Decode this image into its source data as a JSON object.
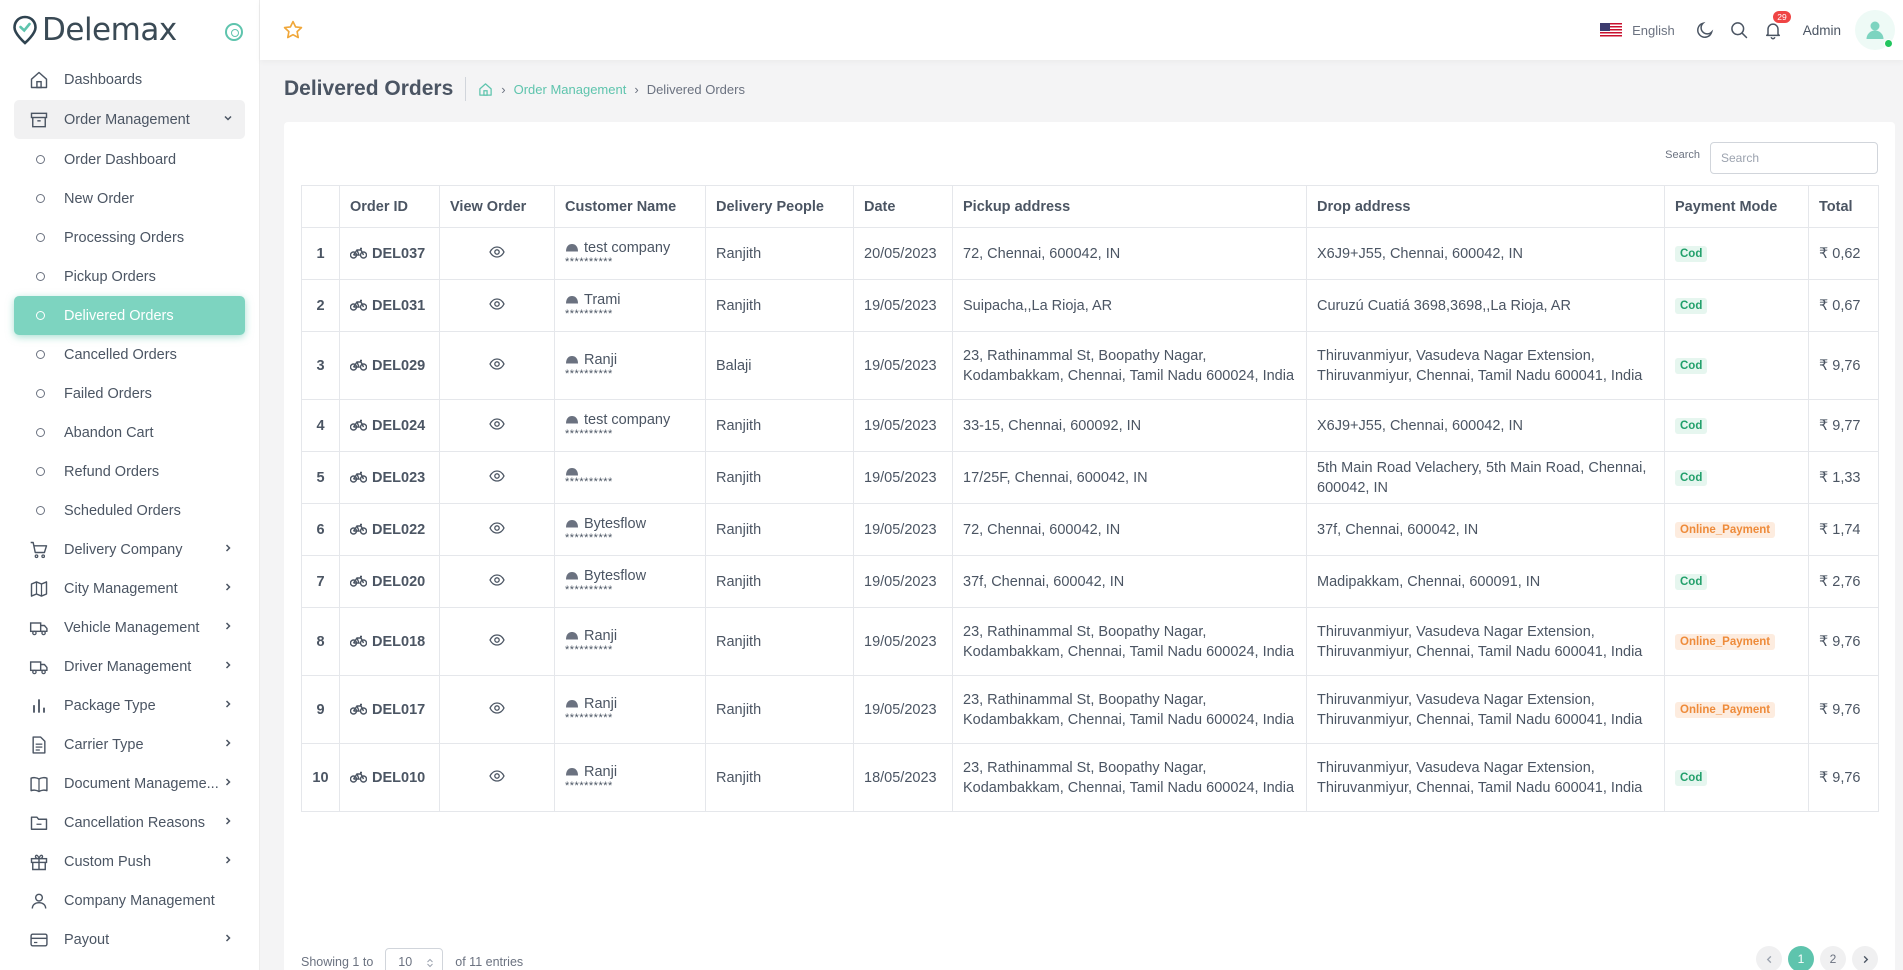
{
  "brand": {
    "name": "Delemax"
  },
  "sidebar": {
    "items": [
      {
        "label": "Dashboards",
        "icon": "home-icon",
        "has_chevron": false
      },
      {
        "label": "Order Management",
        "icon": "archive-box-icon",
        "open": true
      },
      {
        "label": "Delivery Company",
        "icon": "cart-icon",
        "has_chevron": true
      },
      {
        "label": "City Management",
        "icon": "map-icon",
        "has_chevron": true
      },
      {
        "label": "Vehicle Management",
        "icon": "truck-icon",
        "has_chevron": true
      },
      {
        "label": "Driver Management",
        "icon": "truck-icon",
        "has_chevron": true
      },
      {
        "label": "Package Type",
        "icon": "bar-chart-icon",
        "has_chevron": true
      },
      {
        "label": "Carrier Type",
        "icon": "document-icon",
        "has_chevron": true
      },
      {
        "label": "Document Manageme...",
        "icon": "book-icon",
        "has_chevron": true
      },
      {
        "label": "Cancellation Reasons",
        "icon": "folder-icon",
        "has_chevron": true
      },
      {
        "label": "Custom Push",
        "icon": "gift-icon",
        "has_chevron": true
      },
      {
        "label": "Company Management",
        "icon": "user-icon",
        "has_chevron": false
      },
      {
        "label": "Payout",
        "icon": "card-icon",
        "has_chevron": true
      }
    ],
    "order_sub": [
      "Order Dashboard",
      "New Order",
      "Processing Orders",
      "Pickup Orders",
      "Delivered Orders",
      "Cancelled Orders",
      "Failed Orders",
      "Abandon Cart",
      "Refund Orders",
      "Scheduled Orders"
    ],
    "active_sub": "Delivered Orders"
  },
  "topbar": {
    "language": "English",
    "notification_count": "29",
    "user_name": "Admin"
  },
  "page": {
    "title": "Delivered Orders",
    "breadcrumb": {
      "parent": "Order Management",
      "current": "Delivered Orders"
    }
  },
  "search": {
    "label": "Search",
    "placeholder": "Search",
    "value": ""
  },
  "table": {
    "columns": [
      "",
      "Order ID",
      "View Order",
      "Customer Name",
      "Delivery People",
      "Date",
      "Pickup address",
      "Drop address",
      "Payment Mode",
      "Total"
    ],
    "rows": [
      {
        "n": "1",
        "id": "DEL037",
        "customer": "test company",
        "mask": "**********",
        "delivery": "Ranjith",
        "date": "20/05/2023",
        "pickup": "72, Chennai, 600042, IN",
        "drop": "X6J9+J55, Chennai, 600042, IN",
        "payment": "Cod",
        "total": "₹ 0,62"
      },
      {
        "n": "2",
        "id": "DEL031",
        "customer": "Trami",
        "mask": "**********",
        "delivery": "Ranjith",
        "date": "19/05/2023",
        "pickup": "Suipacha,,La Rioja, AR",
        "drop": "Curuzú Cuatiá 3698,3698,,La Rioja, AR",
        "payment": "Cod",
        "total": "₹ 0,67"
      },
      {
        "n": "3",
        "id": "DEL029",
        "customer": "Ranji",
        "mask": "**********",
        "delivery": "Balaji",
        "date": "19/05/2023",
        "pickup": "23, Rathinammal St, Boopathy Nagar, Kodambakkam, Chennai, Tamil Nadu 600024, India",
        "drop": "Thiruvanmiyur, Vasudeva Nagar Extension, Thiruvanmiyur, Chennai, Tamil Nadu 600041, India",
        "payment": "Cod",
        "total": "₹ 9,76"
      },
      {
        "n": "4",
        "id": "DEL024",
        "customer": "test company",
        "mask": "**********",
        "delivery": "Ranjith",
        "date": "19/05/2023",
        "pickup": "33-15, Chennai, 600092, IN",
        "drop": "X6J9+J55, Chennai, 600042, IN",
        "payment": "Cod",
        "total": "₹ 9,77"
      },
      {
        "n": "5",
        "id": "DEL023",
        "customer": "",
        "mask": "**********",
        "delivery": "Ranjith",
        "date": "19/05/2023",
        "pickup": "17/25F, Chennai, 600042, IN",
        "drop": "5th Main Road Velachery, 5th Main Road, Chennai, 600042, IN",
        "payment": "Cod",
        "total": "₹ 1,33"
      },
      {
        "n": "6",
        "id": "DEL022",
        "customer": "Bytesflow",
        "mask": "**********",
        "delivery": "Ranjith",
        "date": "19/05/2023",
        "pickup": "72, Chennai, 600042, IN",
        "drop": "37f, Chennai, 600042, IN",
        "payment": "Online_Payment",
        "total": "₹ 1,74"
      },
      {
        "n": "7",
        "id": "DEL020",
        "customer": "Bytesflow",
        "mask": "**********",
        "delivery": "Ranjith",
        "date": "19/05/2023",
        "pickup": "37f, Chennai, 600042, IN",
        "drop": "Madipakkam, Chennai, 600091, IN",
        "payment": "Cod",
        "total": "₹ 2,76"
      },
      {
        "n": "8",
        "id": "DEL018",
        "customer": "Ranji",
        "mask": "**********",
        "delivery": "Ranjith",
        "date": "19/05/2023",
        "pickup": "23, Rathinammal St, Boopathy Nagar, Kodambakkam, Chennai, Tamil Nadu 600024, India",
        "drop": "Thiruvanmiyur, Vasudeva Nagar Extension, Thiruvanmiyur, Chennai, Tamil Nadu 600041, India",
        "payment": "Online_Payment",
        "total": "₹ 9,76"
      },
      {
        "n": "9",
        "id": "DEL017",
        "customer": "Ranji",
        "mask": "**********",
        "delivery": "Ranjith",
        "date": "19/05/2023",
        "pickup": "23, Rathinammal St, Boopathy Nagar, Kodambakkam, Chennai, Tamil Nadu 600024, India",
        "drop": "Thiruvanmiyur, Vasudeva Nagar Extension, Thiruvanmiyur, Chennai, Tamil Nadu 600041, India",
        "payment": "Online_Payment",
        "total": "₹ 9,76"
      },
      {
        "n": "10",
        "id": "DEL010",
        "customer": "Ranji",
        "mask": "**********",
        "delivery": "Ranjith",
        "date": "18/05/2023",
        "pickup": "23, Rathinammal St, Boopathy Nagar, Kodambakkam, Chennai, Tamil Nadu 600024, India",
        "drop": "Thiruvanmiyur, Vasudeva Nagar Extension, Thiruvanmiyur, Chennai, Tamil Nadu 600041, India",
        "payment": "Cod",
        "total": "₹ 9,76"
      }
    ]
  },
  "footer": {
    "showing_prefix": "Showing 1 to",
    "page_size": "10",
    "showing_suffix": "of 11 entries",
    "pages": [
      "1",
      "2"
    ],
    "current_page": "1"
  },
  "colors": {
    "accent": "#5ec4ad",
    "active_bg": "#7dd4c0",
    "cod_text": "#22a06b",
    "online_text": "#ee8b3a",
    "badge": "#ef4444"
  }
}
